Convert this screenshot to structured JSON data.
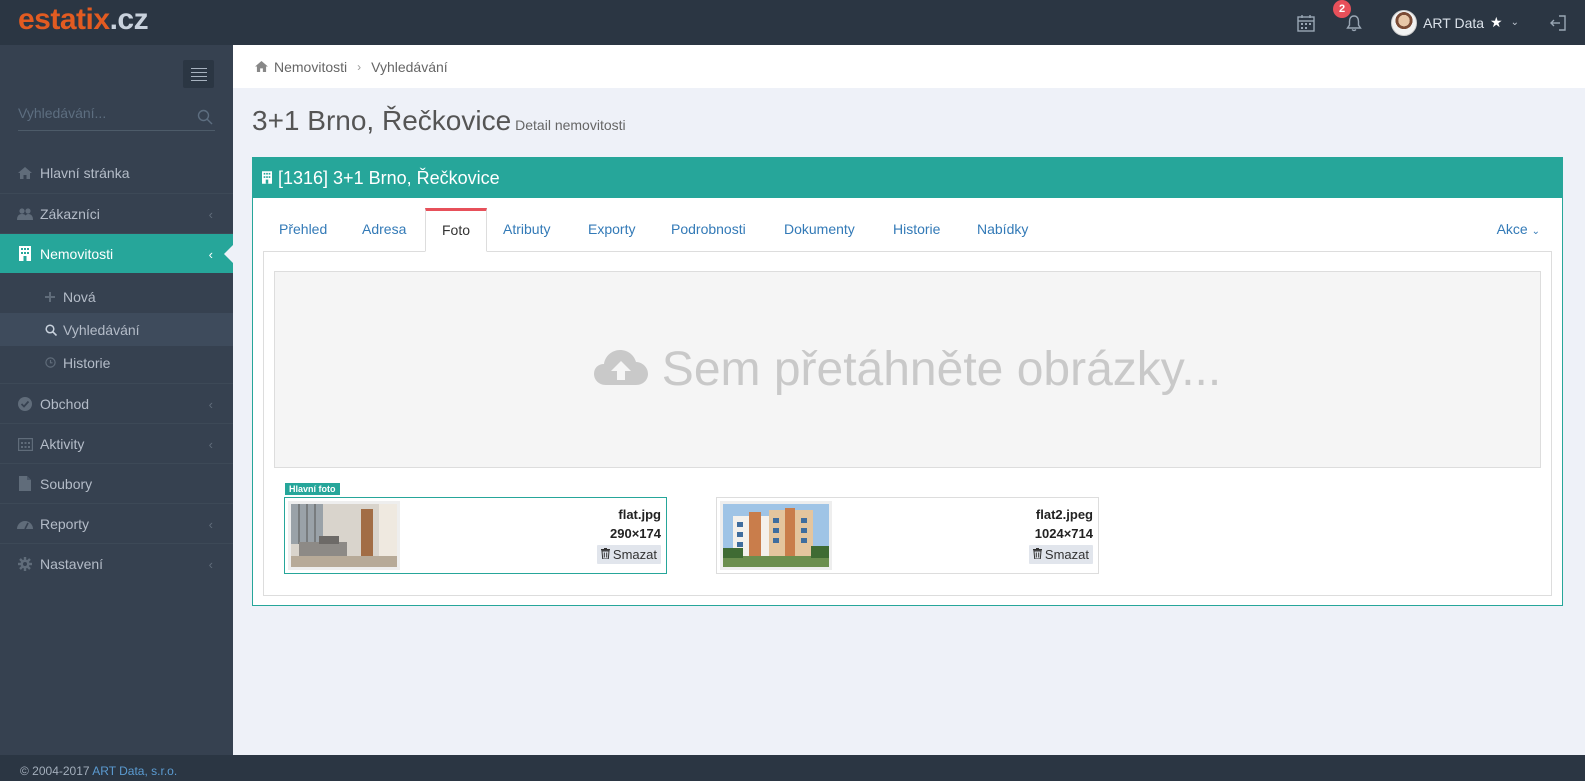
{
  "header": {
    "logo_part1": "estatix",
    "logo_part2": ".cz",
    "notifications_count": "2",
    "user_name": "ART Data"
  },
  "sidebar": {
    "search_placeholder": "Vyhledávání...",
    "items": [
      {
        "label": "Hlavní stránka",
        "icon": "home-icon"
      },
      {
        "label": "Zákazníci",
        "icon": "users-icon"
      },
      {
        "label": "Nemovitosti",
        "icon": "building-icon",
        "active": true
      },
      {
        "label": "Obchod",
        "icon": "check-circle-icon"
      },
      {
        "label": "Aktivity",
        "icon": "calendar-icon"
      },
      {
        "label": "Soubory",
        "icon": "file-icon"
      },
      {
        "label": "Reporty",
        "icon": "dashboard-icon"
      },
      {
        "label": "Nastavení",
        "icon": "gear-icon"
      }
    ],
    "subitems": [
      {
        "label": "Nová",
        "icon": "plus-icon"
      },
      {
        "label": "Vyhledávání",
        "icon": "search-icon",
        "selected": true
      },
      {
        "label": "Historie",
        "icon": "clock-icon"
      }
    ]
  },
  "breadcrumb": {
    "home": "Nemovitosti",
    "current": "Vyhledávání"
  },
  "page": {
    "title": "3+1 Brno, Řečkovice",
    "subtitle": "Detail nemovitosti"
  },
  "portlet": {
    "title": "[1316] 3+1 Brno, Řečkovice",
    "tabs": [
      "Přehled",
      "Adresa",
      "Foto",
      "Atributy",
      "Exporty",
      "Podrobnosti",
      "Dokumenty",
      "Historie",
      "Nabídky"
    ],
    "active_tab": "Foto",
    "actions_label": "Akce",
    "dropzone_text": "Sem přetáhněte obrázky...",
    "main_photo_label": "Hlavní foto",
    "photos": [
      {
        "name": "flat.jpg",
        "size": "290×174",
        "delete_label": "Smazat"
      },
      {
        "name": "flat2.jpeg",
        "size": "1024×714",
        "delete_label": "Smazat"
      }
    ]
  },
  "footer": {
    "copyright": "© 2004-2017",
    "company": "ART Data, s.r.o."
  },
  "colors": {
    "accent": "#26a69a",
    "sidebar": "#364150",
    "header": "#2b3643",
    "tab_active_border": "#e7505a",
    "link": "#337ab7",
    "logo_orange": "#e25b21"
  }
}
